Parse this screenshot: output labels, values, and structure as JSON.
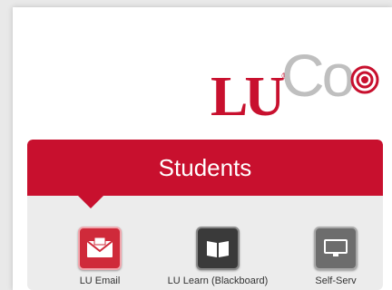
{
  "logo": {
    "text": "LU",
    "trademark": "®",
    "suffix": "Co"
  },
  "panel": {
    "title": "Students"
  },
  "tiles": [
    {
      "label": "LU Email",
      "icon": "envelope-icon"
    },
    {
      "label": "LU Learn (Blackboard)",
      "icon": "book-icon"
    },
    {
      "label": "Self-Serv",
      "icon": "monitor-icon"
    }
  ],
  "colors": {
    "brand_red": "#c8102e",
    "panel_bg": "#ececec",
    "logo_grey": "#bfbfbf"
  }
}
